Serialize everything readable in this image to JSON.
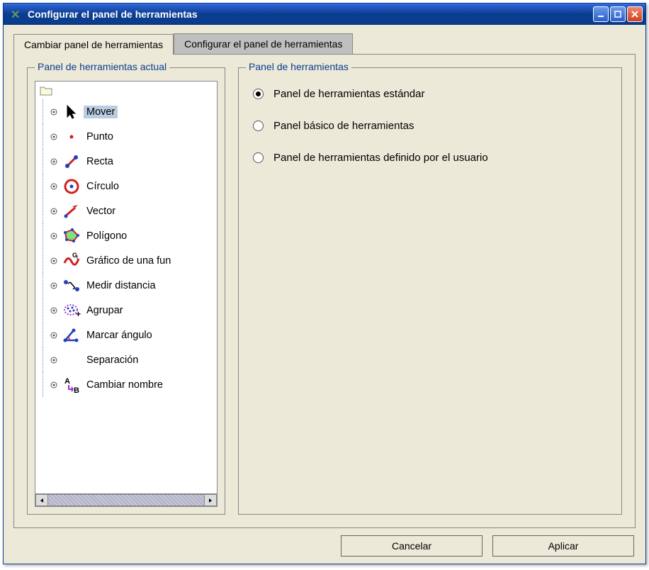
{
  "window": {
    "title": "Configurar el panel de herramientas"
  },
  "tabs": [
    {
      "label": "Cambiar panel de herramientas",
      "active": true
    },
    {
      "label": "Configurar el panel de herramientas",
      "active": false
    }
  ],
  "left_panel": {
    "legend": "Panel de herramientas actual"
  },
  "tree": {
    "items": [
      {
        "id": "mover",
        "label": "Mover",
        "selected": true
      },
      {
        "id": "punto",
        "label": "Punto",
        "selected": false
      },
      {
        "id": "recta",
        "label": "Recta",
        "selected": false
      },
      {
        "id": "circulo",
        "label": "Círculo",
        "selected": false
      },
      {
        "id": "vector",
        "label": "Vector",
        "selected": false
      },
      {
        "id": "poligono",
        "label": "Polígono",
        "selected": false
      },
      {
        "id": "grafico",
        "label": "Gráfico de una fun",
        "selected": false
      },
      {
        "id": "medir",
        "label": "Medir distancia",
        "selected": false
      },
      {
        "id": "agrupar",
        "label": "Agrupar",
        "selected": false
      },
      {
        "id": "angulo",
        "label": "Marcar ángulo",
        "selected": false
      },
      {
        "id": "separacion",
        "label": "Separación",
        "selected": false
      },
      {
        "id": "renombrar",
        "label": "Cambiar nombre",
        "selected": false
      }
    ]
  },
  "right_panel": {
    "legend": "Panel de herramientas",
    "options": [
      {
        "label": "Panel de herramientas estándar",
        "checked": true
      },
      {
        "label": "Panel básico de herramientas",
        "checked": false
      },
      {
        "label": "Panel de herramientas definido por el usuario",
        "checked": false
      }
    ]
  },
  "buttons": {
    "cancel": "Cancelar",
    "apply": "Aplicar"
  }
}
